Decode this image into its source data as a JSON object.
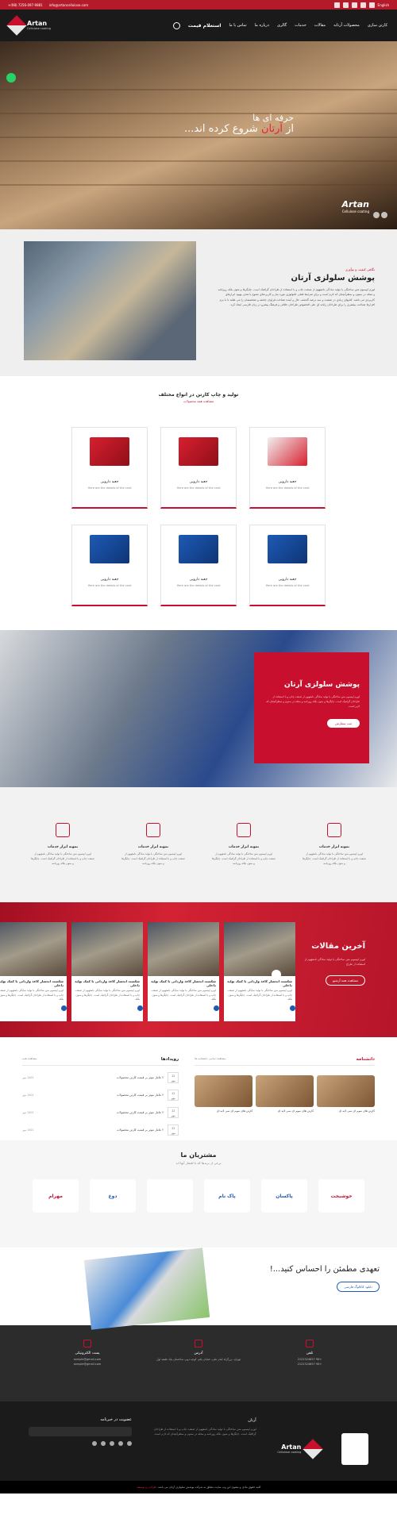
{
  "topbar": {
    "phone": "+(98) 7256-097-9881",
    "email": "info@artancellulose.com",
    "language": "English"
  },
  "header": {
    "logo_text": "Artan",
    "logo_sub": "Cellulose coating",
    "nav": [
      "کارتن سازی",
      "محصولات آرتانه",
      "مقالات",
      "خدمات",
      "گالری",
      "درباره ما",
      "تماس با ما"
    ],
    "cta": "استعلام قیمت"
  },
  "hero": {
    "line1": "حرفه ای ها",
    "line2_pre": "از ",
    "line2_accent": "آرتان",
    "line2_post": " شروع کرده اند...",
    "brand": "Artan",
    "brand_sub": "Cellulose coating"
  },
  "intro": {
    "tag": "نگاهی کیفیت و نوآوری",
    "title": "پوشش سلولزی آرتان",
    "body": "لورم ایپسوم متن ساختگی با تولید سادگی نامفهوم از صنعت چاپ و با استفاده از طراحان گرافیک است. چاپگرها و متون بلکه روزنامه و مجله در ستون و سطرآنچنان که لازم است و برای شرایط فعلی تکنولوژی مورد نیاز و کاربردهای متنوع با هدف بهبود ابزارهای کاربردی می باشد. کتابهای زیادی در شصت و سه درصد گذشته، حال و آینده شناخت فراوان جامعه و متخصصان را می طلبد تا با نرم افزارها شناخت بیشتری را برای طراحان رایانه ای علی الخصوص طراحان خلاقی و فرهنگ پیشرو در زبان فارسی ایجاد کرد."
  },
  "products": {
    "title": "تولید و چاپ کارتن در انواع مختلف",
    "subtitle": "مشاهده همه محصولات",
    "items": [
      {
        "title": "جعبه دارویی",
        "desc": "Here are the details of the card",
        "color": "mix"
      },
      {
        "title": "جعبه دارویی",
        "desc": "Here are the details of the card",
        "color": "red"
      },
      {
        "title": "جعبه دارویی",
        "desc": "Here are the details of the card",
        "color": "red"
      },
      {
        "title": "جعبه دارویی",
        "desc": "Here are the details of the card",
        "color": "blue"
      },
      {
        "title": "جعبه دارویی",
        "desc": "Here are the details of the card",
        "color": "blue"
      },
      {
        "title": "جعبه دارویی",
        "desc": "Here are the details of the card",
        "color": "blue"
      }
    ]
  },
  "banner": {
    "title": "پوشش سلولزی آرتان",
    "body": "لورم ایپسوم متن ساختگی با تولید سادگی نامفهوم از صنعت چاپ و با استفاده از طراحان گرافیک است. چاپگرها و متون بلکه روزنامه و مجله در ستون و سطرآنچنان که لازم است.",
    "button": "ثبت سفارش"
  },
  "services": [
    {
      "title": "نمونه ابزار خدمات",
      "desc": "لورم ایپسوم متن ساختگی با تولید سادگی نامفهوم از صنعت چاپ و با استفاده از طراحان گرافیک است. چاپگرها و متون بلکه روزنامه"
    },
    {
      "title": "نمونه ابزار خدمات",
      "desc": "لورم ایپسوم متن ساختگی با تولید سادگی نامفهوم از صنعت چاپ و با استفاده از طراحان گرافیک است. چاپگرها و متون بلکه روزنامه"
    },
    {
      "title": "نمونه ابزار خدمات",
      "desc": "لورم ایپسوم متن ساختگی با تولید سادگی نامفهوم از صنعت چاپ و با استفاده از طراحان گرافیک است. چاپگرها و متون بلکه روزنامه"
    },
    {
      "title": "نمونه ابزار خدمات",
      "desc": "لورم ایپسوم متن ساختگی با تولید سادگی نامفهوم از صنعت چاپ و با استفاده از طراحان گرافیک است. چاپگرها و متون بلکه روزنامه"
    }
  ],
  "articles": {
    "title": "آخرین مقالات",
    "body": "لورم ایپسوم متن ساختگی با تولید سادگی نامفهوم از استفاده از طراح",
    "button": "مشاهده همه آرشیو",
    "items": [
      {
        "title": "شکست انحصار کاغذ واردانی با کمک تولید داخلی",
        "desc": "لورم ایپسوم متن ساختگی با تولید سادگی نامفهوم از صنعت چاپ و با استفاده از طراحان گرافیک است. چاپگرها و متون بلکه"
      },
      {
        "title": "شکست انحصار کاغذ واردانی با کمک تولید داخلی",
        "desc": "لورم ایپسوم متن ساختگی با تولید سادگی نامفهوم از صنعت چاپ و با استفاده از طراحان گرافیک است. چاپگرها و متون بلکه"
      },
      {
        "title": "شکست انحصار کاغذ واردانی با کمک تولید داخلی",
        "desc": "لورم ایپسوم متن ساختگی با تولید سادگی نامفهوم از صنعت چاپ و با استفاده از طراحان گرافیک است. چاپگرها و متون بلکه"
      },
      {
        "title": "شکست انحصار کاغذ واردانی با کمک تولید داخلی",
        "desc": "لورم ایپسوم متن ساختگی با تولید سادگی نامفهوم از صنعت چاپ و با استفاده از طراحان گرافیک است. چاپگرها و متون بلکه"
      }
    ]
  },
  "knowledge": {
    "title": "دانشنامه",
    "more": "مشاهده تمامی دانشنامه ها",
    "items": [
      {
        "title": "کارتن های سوم ای سی لایه ای"
      },
      {
        "title": "کارتن های سوم ای سی لایه ای"
      },
      {
        "title": "کارتن های سوم ای سی لایه ای"
      }
    ]
  },
  "events": {
    "title": "رویدادها",
    "more": "مشاهده همه",
    "items": [
      {
        "day": "12",
        "month": "مهر",
        "title": "۲ عامل موثر بر قیمت کارتن محصولات",
        "date": "1401 مهر"
      },
      {
        "day": "12",
        "month": "مهر",
        "title": "۲ عامل موثر بر قیمت کارتن محصولات",
        "date": "1401 مهر"
      },
      {
        "day": "12",
        "month": "مهر",
        "title": "۲ عامل موثر بر قیمت کارتن محصولات",
        "date": "1401 مهر"
      },
      {
        "day": "12",
        "month": "مهر",
        "title": "۲ عامل موثر بر قیمت کارتن محصولات",
        "date": "1401 مهر"
      }
    ]
  },
  "customers": {
    "title": "مشتریان ما",
    "subtitle": "برخی از برندها که با افتخار آنها اند",
    "logos": [
      {
        "name": "خوشبخت",
        "color": "#c8102e"
      },
      {
        "name": "پاکسان",
        "color": "#1d5ab5"
      },
      {
        "name": "پاک نام",
        "color": "#1d5ab5"
      },
      {
        "name": "",
        "color": "#c8102e"
      },
      {
        "name": "دوغ",
        "color": "#1d5ab5"
      },
      {
        "name": "مهرام",
        "color": "#c8102e"
      }
    ]
  },
  "catalog": {
    "text_pre": "تعهدی مطمئن را احساس کنید...!",
    "button": "دانلود کاتالوگ فارسی"
  },
  "contact": [
    {
      "title": "تلفن",
      "value": "+98 2122324857\n+98 2122324857"
    },
    {
      "title": "آدرس",
      "value": "تهران، بزرگراه امام علی، خیابان یکم، کوچه دوم، ساختمان پایا، طبقه اول"
    },
    {
      "title": "پست الکترونیکی",
      "value": "sample@gmail.com\nsample@gmail.com"
    }
  ],
  "footer": {
    "about_title": "آرتان",
    "about_body": "لورم ایپسوم متن ساختگی با تولید سادگی نامفهوم از صنعت چاپ و با استفاده از طراحان گرافیک است. چاپگرها و متون بلکه روزنامه و مجله در ستون و سطرآنچنان که لازم است.",
    "newsletter_title": "عضویت در خبرنامه",
    "logo_text": "Artan",
    "logo_sub": "Cellulose coating"
  },
  "bottom": {
    "text": "کلیه حقوق مادی و معنوی این وب سایت متعلق به شرکت پوشش سلولزی آرتان می باشد.",
    "credit": "طراحی و توسعه: "
  }
}
